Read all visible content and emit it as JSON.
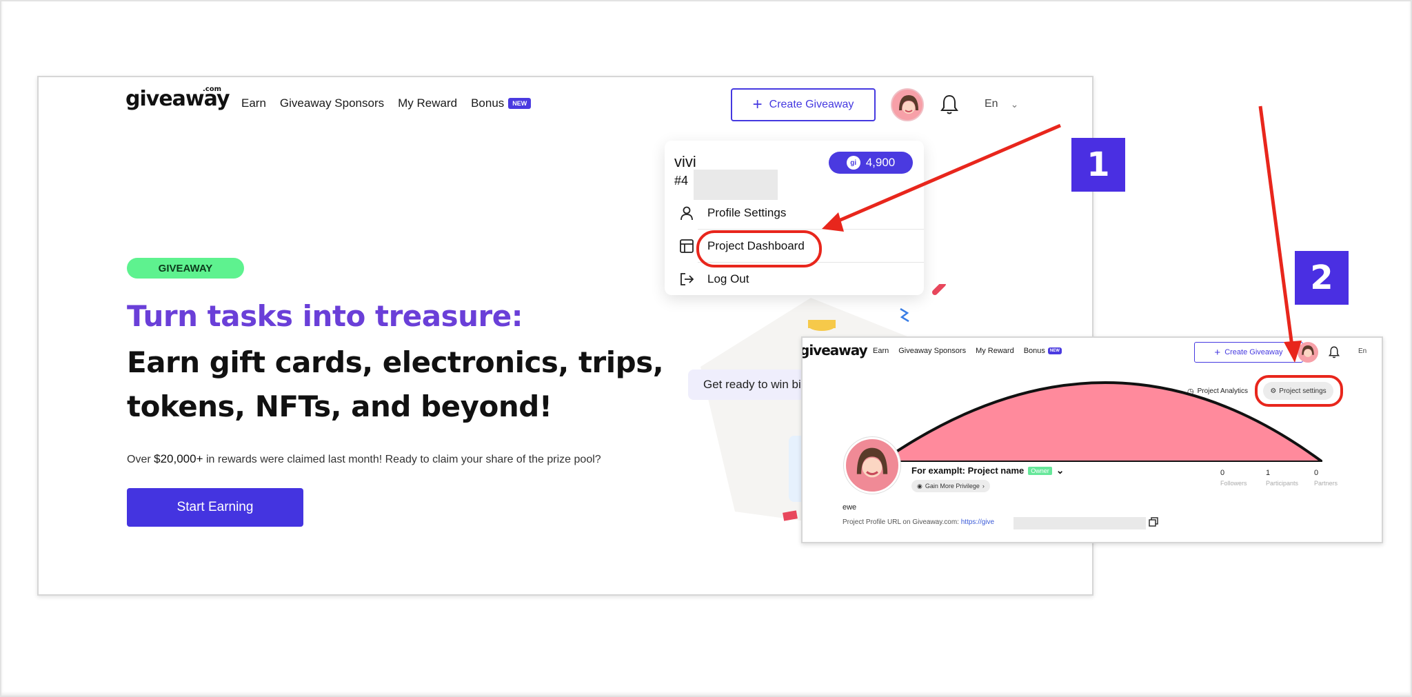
{
  "main": {
    "logo": {
      "text": "giveaway",
      "suffix": ".com"
    },
    "nav": {
      "earn": "Earn",
      "sponsors": "Giveaway Sponsors",
      "my_reward": "My Reward",
      "bonus": "Bonus",
      "bonus_badge": "NEW"
    },
    "create_button": "Create Giveaway",
    "language": "En",
    "hero": {
      "tag": "GIVEAWAY",
      "headline_1": "Turn tasks into treasure:",
      "headline_2": "Earn gift cards, electronics, trips, tokens, NFTs, and beyond!",
      "sub_prefix": "Over ",
      "sub_amount": "$20,000+",
      "sub_suffix": " in rewards were claimed last month! Ready to claim your share of the prize pool?",
      "cta": "Start Earning",
      "ready_pill": "Get ready to win bi"
    },
    "dropdown": {
      "username": "vivi",
      "user_id_prefix": "#4",
      "coin_balance": "4,900",
      "coin_symbol": "gi",
      "items": [
        {
          "label": "Profile Settings",
          "icon": "user-icon"
        },
        {
          "label": "Project Dashboard",
          "icon": "layout-icon"
        },
        {
          "label": "Log Out",
          "icon": "logout-icon"
        }
      ]
    }
  },
  "markers": {
    "step1": "1",
    "step2": "2"
  },
  "inset": {
    "logo": "giveaway",
    "nav": {
      "earn": "Earn",
      "sponsors": "Giveaway Sponsors",
      "my_reward": "My Reward",
      "bonus": "Bonus",
      "bonus_badge": "NEW"
    },
    "create_button": "Create Giveaway",
    "language": "En",
    "tab_analytics": "Project Analytics",
    "tab_settings": "Project settings",
    "project_name": "For examplt: Project name",
    "owner_tag": "Owner",
    "gain_privilege": "Gain More Privilege",
    "stats": [
      {
        "value": "0",
        "label": "Followers"
      },
      {
        "value": "1",
        "label": "Participants"
      },
      {
        "value": "0",
        "label": "Partners"
      }
    ],
    "description": "ewe",
    "url_label": "Project Profile URL on Giveaway.com: ",
    "url_value": "https://give"
  },
  "colors": {
    "brand": "#4434e0",
    "headline_purple": "#6a3fd8",
    "tag_green": "#5ef28f",
    "annotation_red": "#e8261c",
    "marker": "#4a2fe2",
    "banner_pink": "#ff8a9c"
  }
}
